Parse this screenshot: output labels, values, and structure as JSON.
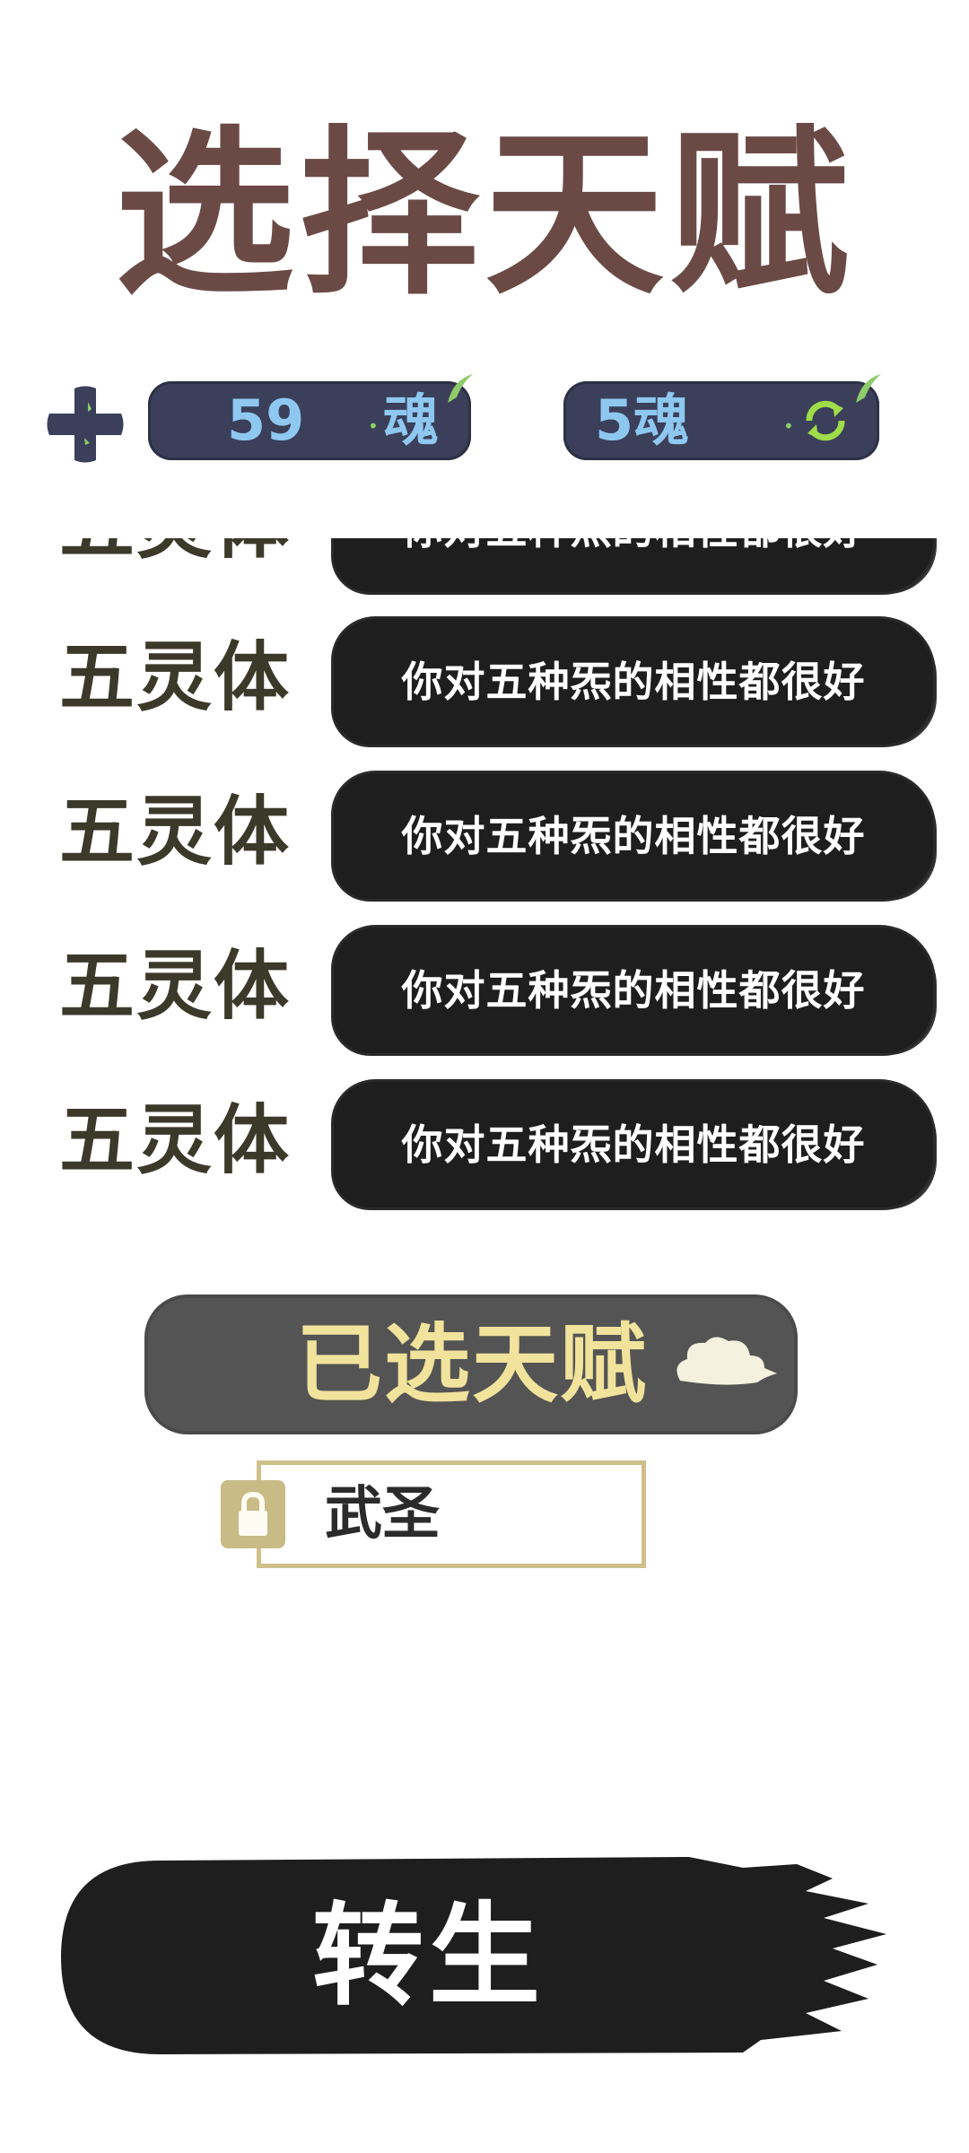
{
  "title": "选择天赋",
  "resources": {
    "soul_count": "59",
    "soul_unit": "魂",
    "refresh_cost": "5魂"
  },
  "talents": [
    {
      "name": "五灵体",
      "desc": "你对五种炁的相性都很好"
    },
    {
      "name": "五灵体",
      "desc": "你对五种炁的相性都很好"
    },
    {
      "name": "五灵体",
      "desc": "你对五种炁的相性都很好"
    },
    {
      "name": "五灵体",
      "desc": "你对五种炁的相性都很好"
    },
    {
      "name": "五灵体",
      "desc": "你对五种炁的相性都很好"
    }
  ],
  "selected_header": "已选天赋",
  "selected_talents": [
    "武圣"
  ],
  "rebirth_label": "转生",
  "colors": {
    "title": "#6b4a45",
    "pill_bg": "#3b3f59",
    "pill_text": "#8ec8f0",
    "ink": "#1e1e1e",
    "selected_header_text": "#f1e39c",
    "gold_frame": "#cfc08a"
  },
  "icons": {
    "add": "plus-icon",
    "refresh": "refresh-icon",
    "lock": "lock-icon",
    "cloud": "cloud-icon"
  }
}
